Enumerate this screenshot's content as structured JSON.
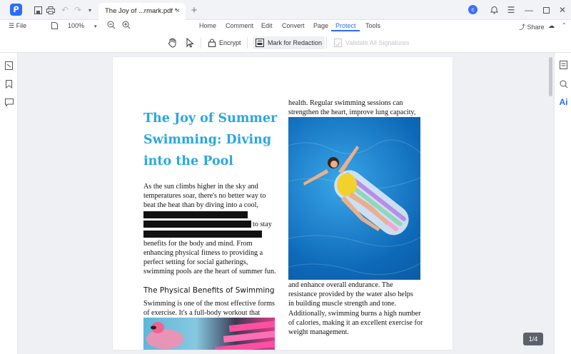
{
  "titlebar": {
    "tab_title": "The Joy of ...rmark.pdf *",
    "tab_close": "×",
    "tab_add": "+"
  },
  "menubar": {
    "file_label": "File",
    "zoom_value": "100%",
    "tabs": [
      "Home",
      "Comment",
      "Edit",
      "Convert",
      "Page",
      "Protect",
      "Tools"
    ],
    "share_label": "Share"
  },
  "toolbar": {
    "encrypt_label": "Encrypt",
    "redact_label": "Mark for Redaction",
    "validate_label": "Validate All Signatures"
  },
  "right_panel": {
    "ai_label": "Ai"
  },
  "document": {
    "title": "The Joy of Summer Swimming: Diving into the Pool",
    "para1_lines": [
      "As the sun climbs higher in the sky and",
      "temperatures soar, there's no better way to",
      "beat the heat than by diving into a cool,"
    ],
    "redacted_tail": "to stay",
    "para1_rest": [
      "benefits for the body and mind. From",
      "enhancing physical fitness to providing a",
      "perfect setting for social gatherings,",
      "swimming pools are the heart of summer fun."
    ],
    "subheading": "The Physical Benefits of Swimming",
    "para2_lines": [
      "Swimming is one of the most effective forms",
      "of exercise. It's a full-body workout that"
    ],
    "col2_top": [
      "health. Regular swimming sessions can",
      "strengthen the heart, improve lung capacity,"
    ],
    "col2_bottom": [
      "and enhance overall endurance. The",
      "resistance provided by the water also helps",
      "in building muscle strength and tone.",
      "Additionally, swimming burns a high number",
      "of calories, making it an excellent exercise for",
      "weight management."
    ]
  },
  "page_indicator": "1/4",
  "colors": {
    "accent": "#2b6cff",
    "title": "#2aa7df"
  }
}
